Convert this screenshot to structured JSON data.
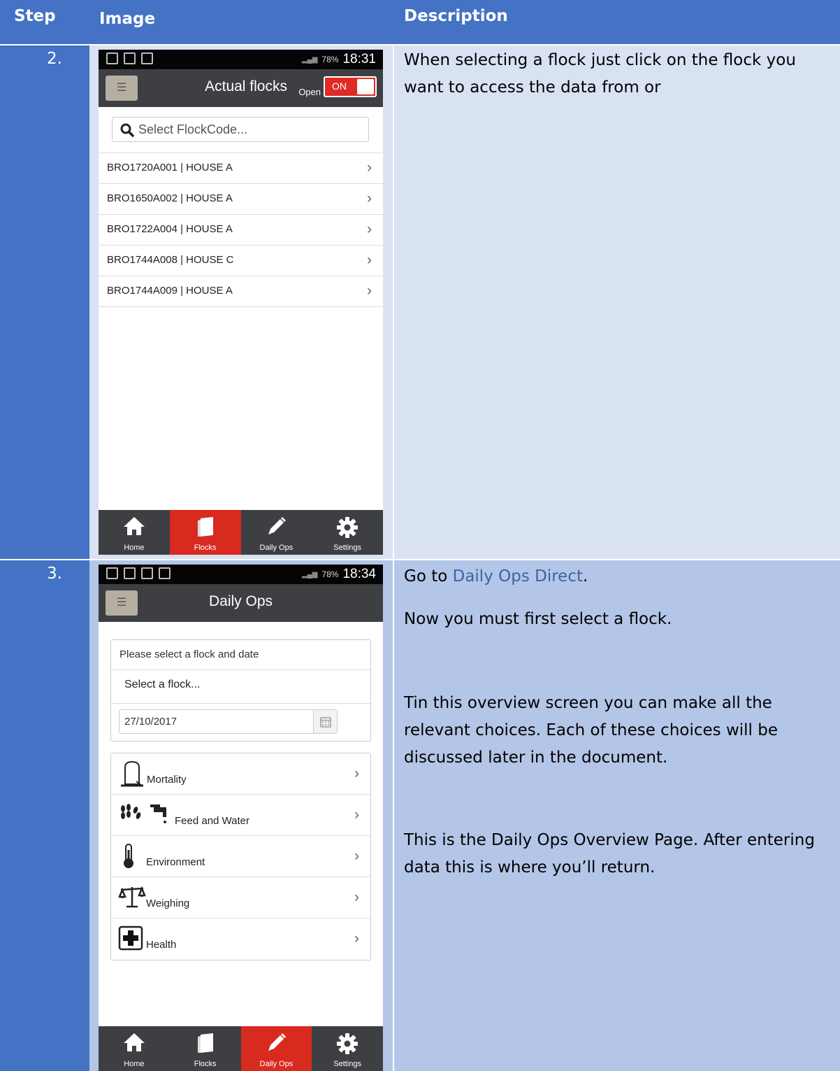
{
  "table_header": {
    "step": "Step",
    "image": "Image",
    "description": "Description"
  },
  "rows": [
    {
      "step": "2.",
      "description": [
        "When selecting a flock just click on the flock you want to access the data from or"
      ],
      "screen": {
        "status": {
          "battery": "78%",
          "time": "18:31"
        },
        "title": "Actual flocks",
        "open_label": "Open",
        "toggle_label": "ON",
        "search_placeholder": "Select FlockCode...",
        "flocks": [
          "BRO1720A001 | HOUSE A",
          "BRO1650A002 | HOUSE A",
          "BRO1722A004 | HOUSE A",
          "BRO1744A008 | HOUSE C",
          "BRO1744A009 | HOUSE A"
        ]
      }
    },
    {
      "step": "3.",
      "description_line1_prefix": "Go to ",
      "description_line1_link": "Daily Ops Direct",
      "description_line1_suffix": ".",
      "description": [
        "Now you must first select a flock.",
        "Tin this overview screen you can make all the relevant choices. Each of these choices will be discussed later in the document.",
        "This is the Daily Ops Overview Page. After entering data this is where you’ll return."
      ],
      "screen": {
        "status": {
          "battery": "78%",
          "time": "18:34"
        },
        "title": "Daily Ops",
        "prompt": "Please select a flock and date",
        "flock_select": "Select a flock...",
        "date": "27/10/2017",
        "menu": [
          "Mortality",
          "Feed and Water",
          "Environment",
          "Weighing",
          "Health"
        ]
      }
    }
  ],
  "tabs": [
    "Home",
    "Flocks",
    "Daily Ops",
    "Settings"
  ]
}
